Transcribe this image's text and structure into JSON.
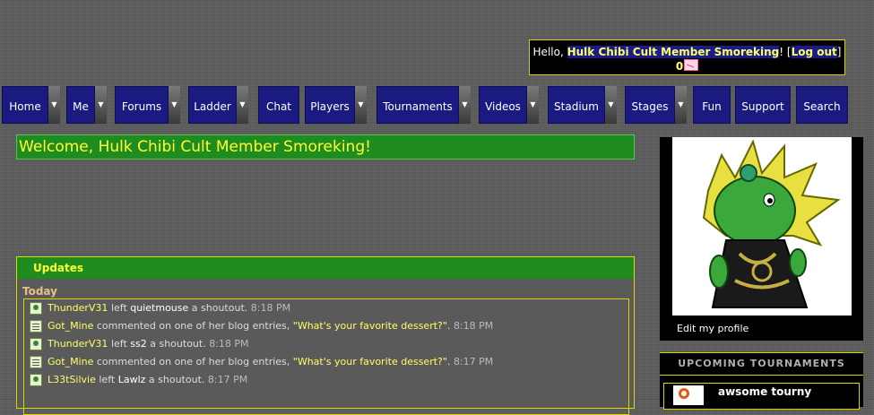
{
  "header": {
    "greeting_prefix": "Hello,",
    "username": "Hulk Chibi Cult Member Smoreking",
    "exclaim": "!",
    "bracket_open": "[",
    "logout": "Log out",
    "bracket_close": "]",
    "message_count": "0"
  },
  "nav": [
    {
      "label": "Home"
    },
    {
      "label": "Me"
    },
    {
      "label": "Forums"
    },
    {
      "label": "Ladder"
    },
    {
      "label": "Chat"
    },
    {
      "label": "Players"
    },
    {
      "label": "Tournaments"
    },
    {
      "label": "Videos"
    },
    {
      "label": "Stadium"
    },
    {
      "label": "Stages"
    },
    {
      "label": "Fun"
    },
    {
      "label": "Support"
    },
    {
      "label": "Search"
    }
  ],
  "welcome": "Welcome, Hulk Chibi Cult Member Smoreking!",
  "updates": {
    "title": "Updates",
    "day": "Today",
    "rows": [
      {
        "icon": "user-icon",
        "user": "ThunderV31",
        "verb": "left",
        "target": "quietmouse",
        "suffix": "a shoutout.",
        "time": "8:18 PM"
      },
      {
        "icon": "blog-icon",
        "user": "Got_Mine",
        "verb": "commented on one of her blog entries,",
        "target": "\"What's your favorite dessert?\"",
        "suffix": ".",
        "time": "8:18 PM"
      },
      {
        "icon": "user-icon",
        "user": "ThunderV31",
        "verb": "left",
        "target": "ss2",
        "suffix": "a shoutout.",
        "time": "8:18 PM"
      },
      {
        "icon": "blog-icon",
        "user": "Got_Mine",
        "verb": "commented on one of her blog entries,",
        "target": "\"What's your favorite dessert?\"",
        "suffix": ".",
        "time": "8:17 PM"
      },
      {
        "icon": "user-icon",
        "user": "L33tSilvie",
        "verb": "left",
        "target": "Lawlz",
        "suffix": "a shoutout.",
        "time": "8:17 PM"
      }
    ]
  },
  "profile": {
    "edit_label": "Edit my profile"
  },
  "upcoming": {
    "title": "UPCOMING TOURNAMENTS",
    "first_title": "awsome tourny"
  }
}
